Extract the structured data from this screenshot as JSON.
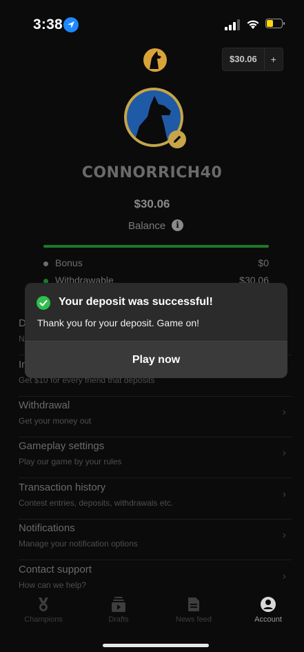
{
  "status_bar": {
    "time": "3:38"
  },
  "header": {
    "wallet_amount": "$30.06",
    "wallet_plus": "+"
  },
  "profile": {
    "username": "CONNORRICH40",
    "balance_amount": "$30.06",
    "balance_label": "Balance",
    "info_glyph": "i"
  },
  "balance_breakdown": [
    {
      "label": "Bonus",
      "value": "$0"
    },
    {
      "label": "Withdrawable",
      "value": "$30.06"
    }
  ],
  "menu": [
    {
      "title": "D",
      "subtitle": "N"
    },
    {
      "title": "In",
      "subtitle": "Get $10 for every friend that deposits"
    },
    {
      "title": "Withdrawal",
      "subtitle": "Get your money out"
    },
    {
      "title": "Gameplay settings",
      "subtitle": "Play our game by your rules"
    },
    {
      "title": "Transaction history",
      "subtitle": "Contest entries, deposits, withdrawals etc."
    },
    {
      "title": "Notifications",
      "subtitle": "Manage your notification options"
    },
    {
      "title": "Contact support",
      "subtitle": "How can we help?"
    }
  ],
  "toast": {
    "title": "Your deposit was successful!",
    "message": "Thank you for your deposit. Game on!",
    "button": "Play now"
  },
  "tabbar": [
    {
      "label": "Champions",
      "icon": "medal-icon",
      "active": false
    },
    {
      "label": "Drafts",
      "icon": "drafts-icon",
      "active": false
    },
    {
      "label": "News feed",
      "icon": "news-icon",
      "active": false
    },
    {
      "label": "Account",
      "icon": "account-icon",
      "active": true
    }
  ],
  "colors": {
    "accent_green": "#2fbf4c",
    "gold": "#c7a548",
    "avatar_blue": "#1f5aa6",
    "battery_yellow": "#ffd60a",
    "location_blue": "#1e88ff"
  },
  "battery_level": 0.45
}
